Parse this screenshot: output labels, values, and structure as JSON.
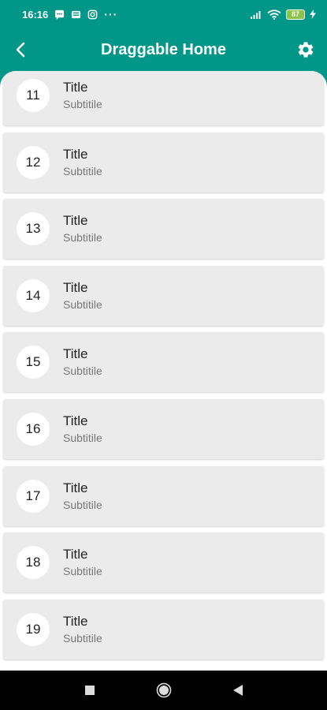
{
  "status_bar": {
    "time": "16:16",
    "more": "···",
    "battery": "87",
    "icons": [
      "message-icon",
      "news-icon",
      "instagram-icon",
      "signal-icon",
      "wifi-icon",
      "battery-icon",
      "charging-icon"
    ]
  },
  "app_bar": {
    "title": "Draggable Home",
    "back_icon": "chevron-left-icon",
    "settings_icon": "gear-icon"
  },
  "list": {
    "items": [
      {
        "number": "11",
        "title": "Title",
        "subtitle": "Subtitile"
      },
      {
        "number": "12",
        "title": "Title",
        "subtitle": "Subtitile"
      },
      {
        "number": "13",
        "title": "Title",
        "subtitle": "Subtitile"
      },
      {
        "number": "14",
        "title": "Title",
        "subtitle": "Subtitile"
      },
      {
        "number": "15",
        "title": "Title",
        "subtitle": "Subtitile"
      },
      {
        "number": "16",
        "title": "Title",
        "subtitle": "Subtitile"
      },
      {
        "number": "17",
        "title": "Title",
        "subtitle": "Subtitile"
      },
      {
        "number": "18",
        "title": "Title",
        "subtitle": "Subtitile"
      },
      {
        "number": "19",
        "title": "Title",
        "subtitle": "Subtitile"
      }
    ]
  },
  "nav_bar": {
    "icons": [
      "recents-square-icon",
      "home-circle-icon",
      "back-triangle-icon"
    ]
  },
  "colors": {
    "primary": "#009688",
    "card": "#ebebeb",
    "subtitle": "#777777"
  }
}
